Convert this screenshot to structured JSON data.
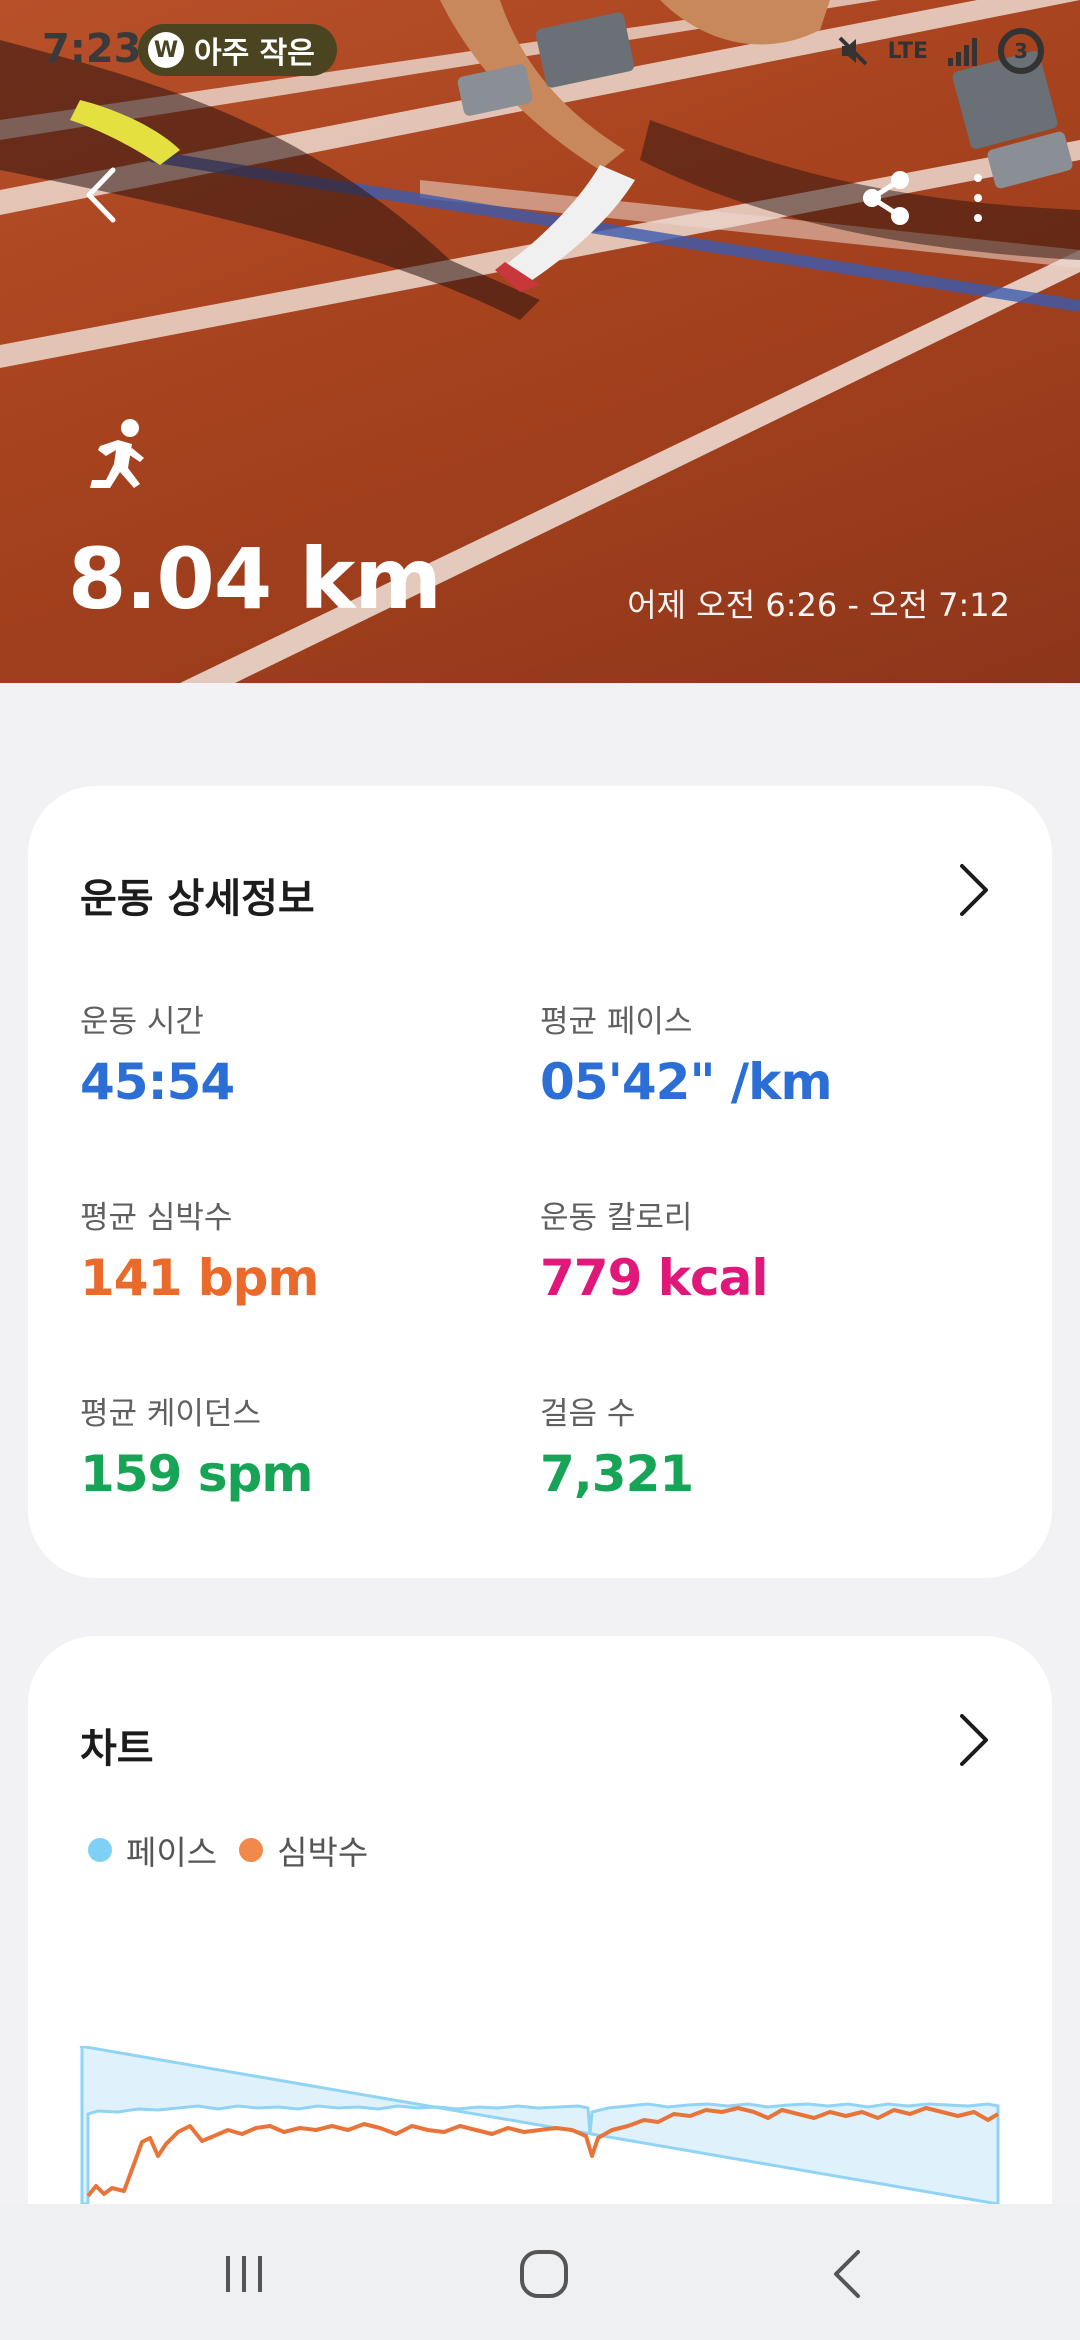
{
  "status": {
    "time": "7:23",
    "pill_text": "아주 작은",
    "network": "LTE",
    "battery": "3"
  },
  "hero": {
    "distance": "8.04 km",
    "time_range": "어제 오전 6:26 - 오전 7:12"
  },
  "details": {
    "title": "운동 상세정보",
    "stats": [
      {
        "label": "운동 시간",
        "value": "45:54",
        "color": "#2b6fd6"
      },
      {
        "label": "평균 페이스",
        "value": "05'42\" /km",
        "color": "#2b6fd6"
      },
      {
        "label": "평균 심박수",
        "value": "141 bpm",
        "color": "#ea6a2c"
      },
      {
        "label": "운동 칼로리",
        "value": "779 kcal",
        "color": "#e0187a"
      },
      {
        "label": "평균 케이던스",
        "value": "159 spm",
        "color": "#18a456"
      },
      {
        "label": "걸음 수",
        "value": "7,321",
        "color": "#18a456"
      }
    ]
  },
  "chart": {
    "title": "차트",
    "legend": [
      {
        "name": "페이스",
        "color": "#7fd0f5"
      },
      {
        "name": "심박수",
        "color": "#f0894a"
      }
    ]
  },
  "icons": {
    "back": "chevron-left-icon",
    "share": "share-icon",
    "more": "more-vertical-icon",
    "activity": "running-icon",
    "nav_recents": "recents-icon",
    "nav_home": "home-icon",
    "nav_back": "back-icon"
  }
}
